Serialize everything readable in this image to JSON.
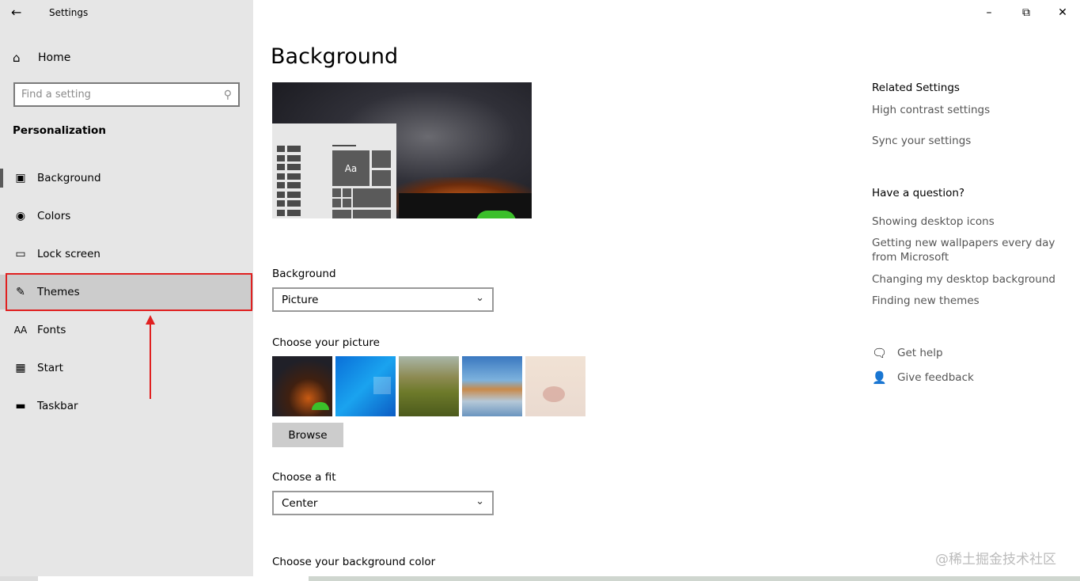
{
  "window": {
    "title": "Settings",
    "back_icon": "arrow-left-icon",
    "minimize_icon": "minimize-icon",
    "restore_icon": "restore-icon",
    "close_icon": "close-icon"
  },
  "sidebar": {
    "home_label": "Home",
    "search_placeholder": "Find a setting",
    "section_title": "Personalization",
    "items": [
      {
        "label": "Background",
        "icon": "picture-icon"
      },
      {
        "label": "Colors",
        "icon": "palette-icon"
      },
      {
        "label": "Lock screen",
        "icon": "lock-screen-icon"
      },
      {
        "label": "Themes",
        "icon": "themes-icon"
      },
      {
        "label": "Fonts",
        "icon": "fonts-icon"
      },
      {
        "label": "Start",
        "icon": "start-icon"
      },
      {
        "label": "Taskbar",
        "icon": "taskbar-icon"
      }
    ]
  },
  "main": {
    "title": "Background",
    "preview_tile_text": "Aa",
    "background_label": "Background",
    "background_value": "Picture",
    "choose_picture_label": "Choose your picture",
    "browse_label": "Browse",
    "fit_label": "Choose a fit",
    "fit_value": "Center",
    "color_label": "Choose your background color"
  },
  "related": {
    "title": "Related Settings",
    "links": [
      "High contrast settings",
      "Sync your settings"
    ]
  },
  "question": {
    "title": "Have a question?",
    "links": [
      "Showing desktop icons",
      "Getting new wallpapers every day from Microsoft",
      "Changing my desktop background",
      "Finding new themes"
    ]
  },
  "help": {
    "get_help": "Get help",
    "give_feedback": "Give feedback"
  },
  "watermark": "@稀土掘金技术社区",
  "colors": {
    "highlight_border": "#e02020",
    "sidebar_bg": "#e6e6e6"
  }
}
